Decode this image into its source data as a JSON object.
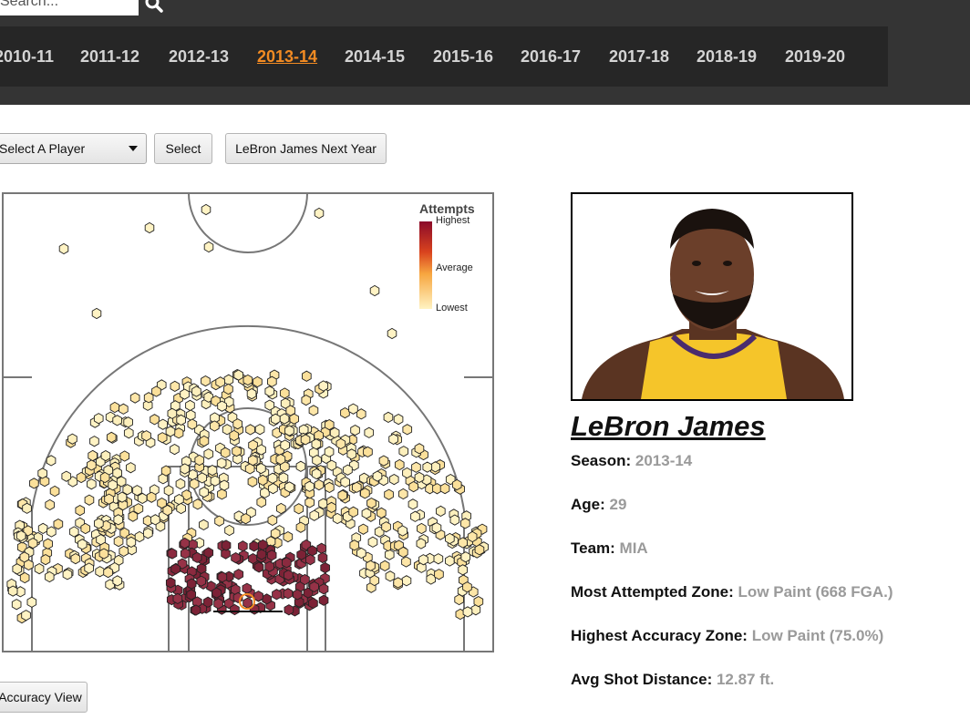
{
  "search": {
    "placeholder": "Search..."
  },
  "seasons": [
    {
      "label": "2010-11",
      "active": false
    },
    {
      "label": "2011-12",
      "active": false
    },
    {
      "label": "2012-13",
      "active": false
    },
    {
      "label": "2013-14",
      "active": true
    },
    {
      "label": "2014-15",
      "active": false
    },
    {
      "label": "2015-16",
      "active": false
    },
    {
      "label": "2016-17",
      "active": false
    },
    {
      "label": "2017-18",
      "active": false
    },
    {
      "label": "2018-19",
      "active": false
    },
    {
      "label": "2019-20",
      "active": false
    }
  ],
  "controls": {
    "player_select": "Select A Player",
    "select_button": "Select",
    "next_year_button": "LeBron James Next Year",
    "accuracy_button": "Accuracy View"
  },
  "legend": {
    "title": "Attempts",
    "high": "Highest",
    "mid": "Average",
    "low": "Lowest"
  },
  "player": {
    "name": "LeBron James",
    "season_label": "Season:",
    "season": "2013-14",
    "age_label": "Age:",
    "age": "29",
    "team_label": "Team:",
    "team": "MIA",
    "most_zone_label": "Most Attempted Zone:",
    "most_zone": "Low Paint (668 FGA.)",
    "accuracy_zone_label": "Highest Accuracy Zone:",
    "accuracy_zone": "Low Paint (75.0%)",
    "avg_dist_label": "Avg Shot Distance:",
    "avg_dist": "12.87 ft."
  },
  "colors": {
    "accent": "#f28b23",
    "hot": "#8b2a3f",
    "cool": "#fde9b4"
  }
}
